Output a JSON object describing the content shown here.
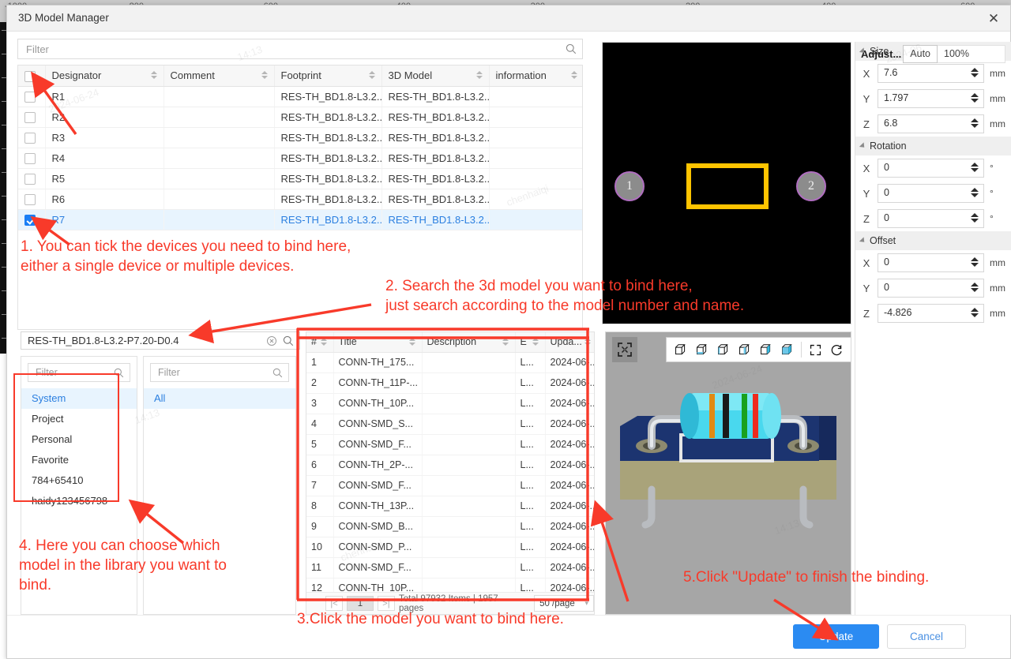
{
  "window": {
    "title": "3D Model Manager",
    "close_icon": "close-icon"
  },
  "background_ruler": [
    "-1000",
    "-800",
    "-600",
    "-400",
    "-200",
    "200",
    "400",
    "600"
  ],
  "designator_panel": {
    "filter_placeholder": "Filter",
    "search_icon": "search-icon",
    "columns": [
      "Designator",
      "Comment",
      "Footprint",
      "3D Model",
      "information"
    ],
    "rows": [
      {
        "checked": false,
        "designator": "R1",
        "comment": "",
        "footprint": "RES-TH_BD1.8-L3.2...",
        "model": "RES-TH_BD1.8-L3.2...",
        "information": ""
      },
      {
        "checked": false,
        "designator": "R2",
        "comment": "",
        "footprint": "RES-TH_BD1.8-L3.2...",
        "model": "RES-TH_BD1.8-L3.2...",
        "information": ""
      },
      {
        "checked": false,
        "designator": "R3",
        "comment": "",
        "footprint": "RES-TH_BD1.8-L3.2...",
        "model": "RES-TH_BD1.8-L3.2...",
        "information": ""
      },
      {
        "checked": false,
        "designator": "R4",
        "comment": "",
        "footprint": "RES-TH_BD1.8-L3.2...",
        "model": "RES-TH_BD1.8-L3.2...",
        "information": ""
      },
      {
        "checked": false,
        "designator": "R5",
        "comment": "",
        "footprint": "RES-TH_BD1.8-L3.2...",
        "model": "RES-TH_BD1.8-L3.2...",
        "information": ""
      },
      {
        "checked": false,
        "designator": "R6",
        "comment": "",
        "footprint": "RES-TH_BD1.8-L3.2...",
        "model": "RES-TH_BD1.8-L3.2...",
        "information": ""
      },
      {
        "checked": true,
        "designator": "R7",
        "comment": "",
        "footprint": "RES-TH_BD1.8-L3.2...",
        "model": "RES-TH_BD1.8-L3.2...",
        "information": ""
      }
    ]
  },
  "footprint_preview": {
    "pad1_label": "1",
    "pad2_label": "2",
    "background": "#000000",
    "body_color": "#ffc400",
    "pad_color": "#8c8c8c"
  },
  "properties": {
    "header_label": "Adjust...",
    "auto_button": "Auto",
    "scale_value": "100%",
    "sections": [
      {
        "name": "Size",
        "fields": [
          {
            "axis": "X",
            "value": "7.6",
            "unit": "mm"
          },
          {
            "axis": "Y",
            "value": "1.797",
            "unit": "mm"
          },
          {
            "axis": "Z",
            "value": "6.8",
            "unit": "mm"
          }
        ]
      },
      {
        "name": "Rotation",
        "fields": [
          {
            "axis": "X",
            "value": "0",
            "unit": "°"
          },
          {
            "axis": "Y",
            "value": "0",
            "unit": "°"
          },
          {
            "axis": "Z",
            "value": "0",
            "unit": "°"
          }
        ]
      },
      {
        "name": "Offset",
        "fields": [
          {
            "axis": "X",
            "value": "0",
            "unit": "mm"
          },
          {
            "axis": "Y",
            "value": "0",
            "unit": "mm"
          },
          {
            "axis": "Z",
            "value": "-4.826",
            "unit": "mm"
          }
        ]
      }
    ]
  },
  "model_search": {
    "value": "RES-TH_BD1.8-L3.2-P7.20-D0.4",
    "clear_icon": "clear-circle-icon",
    "search_icon": "search-icon"
  },
  "library_panel": {
    "filter_placeholder": "Filter",
    "search_icon": "search-icon",
    "sources": [
      {
        "label": "System",
        "active": true
      },
      {
        "label": "Project",
        "active": false
      },
      {
        "label": "Personal",
        "active": false
      },
      {
        "label": "Favorite",
        "active": false
      },
      {
        "label": "784+65410",
        "active": false
      },
      {
        "label": "haidy123456798",
        "active": false
      }
    ],
    "categories": [
      {
        "label": "All",
        "active": true
      }
    ]
  },
  "model_list": {
    "columns": [
      "#",
      "Title",
      "Description",
      "E",
      "Upda..."
    ],
    "rows": [
      {
        "index": "1",
        "title": "CONN-TH_175...",
        "description": "",
        "e": "L...",
        "updated": "2024-06-..."
      },
      {
        "index": "2",
        "title": "CONN-TH_11P-...",
        "description": "",
        "e": "L...",
        "updated": "2024-06-..."
      },
      {
        "index": "3",
        "title": "CONN-TH_10P...",
        "description": "",
        "e": "L...",
        "updated": "2024-06-..."
      },
      {
        "index": "4",
        "title": "CONN-SMD_S...",
        "description": "",
        "e": "L...",
        "updated": "2024-06-..."
      },
      {
        "index": "5",
        "title": "CONN-SMD_F...",
        "description": "",
        "e": "L...",
        "updated": "2024-06-..."
      },
      {
        "index": "6",
        "title": "CONN-TH_2P-...",
        "description": "",
        "e": "L...",
        "updated": "2024-06-..."
      },
      {
        "index": "7",
        "title": "CONN-SMD_F...",
        "description": "",
        "e": "L...",
        "updated": "2024-06-..."
      },
      {
        "index": "8",
        "title": "CONN-TH_13P...",
        "description": "",
        "e": "L...",
        "updated": "2024-06-..."
      },
      {
        "index": "9",
        "title": "CONN-SMD_B...",
        "description": "",
        "e": "L...",
        "updated": "2024-06-..."
      },
      {
        "index": "10",
        "title": "CONN-SMD_P...",
        "description": "",
        "e": "L...",
        "updated": "2024-06-..."
      },
      {
        "index": "11",
        "title": "CONN-SMD_F...",
        "description": "",
        "e": "L...",
        "updated": "2024-06-..."
      },
      {
        "index": "12",
        "title": "CONN-TH_10P...",
        "description": "",
        "e": "L...",
        "updated": "2024-06-..."
      }
    ],
    "pagination": {
      "first_icon": "first-page-icon",
      "current_page": "1",
      "next_icon": "next-page-icon",
      "summary": "Total 97932 Items | 1957 pages",
      "page_size": "50 /page",
      "chevron_icon": "chevron-down-icon"
    }
  },
  "viewer": {
    "fit_icon": "fit-to-screen-icon",
    "view_icons": [
      "view-iso-icon",
      "view-bottom-icon",
      "view-left-icon",
      "view-right-icon",
      "view-front-icon",
      "view-back-icon"
    ],
    "fullscreen_icon": "fullscreen-icon",
    "reset-rotation_icon": "reset-rotation-icon",
    "background": "#a6a6a6"
  },
  "footer": {
    "update_label": "Update",
    "cancel_label": "Cancel",
    "update_color": "#2b8bf2"
  },
  "annotations": {
    "accent_color": "#f83a2a",
    "step1": "1. You can tick the devices you need to bind here,\neither a single device or multiple devices.",
    "step2": "2. Search the 3d model you want to bind here,\njust search according to the model number and name.",
    "step3": "3.Click the model you want to bind here.",
    "step4": "4. Here you can choose which\nmodel in the library you want to\nbind.",
    "step5": "5.Click \"Update\" to finish the binding."
  },
  "watermarks": [
    "2024-06-24",
    "14:13",
    "chenhaiqi"
  ]
}
